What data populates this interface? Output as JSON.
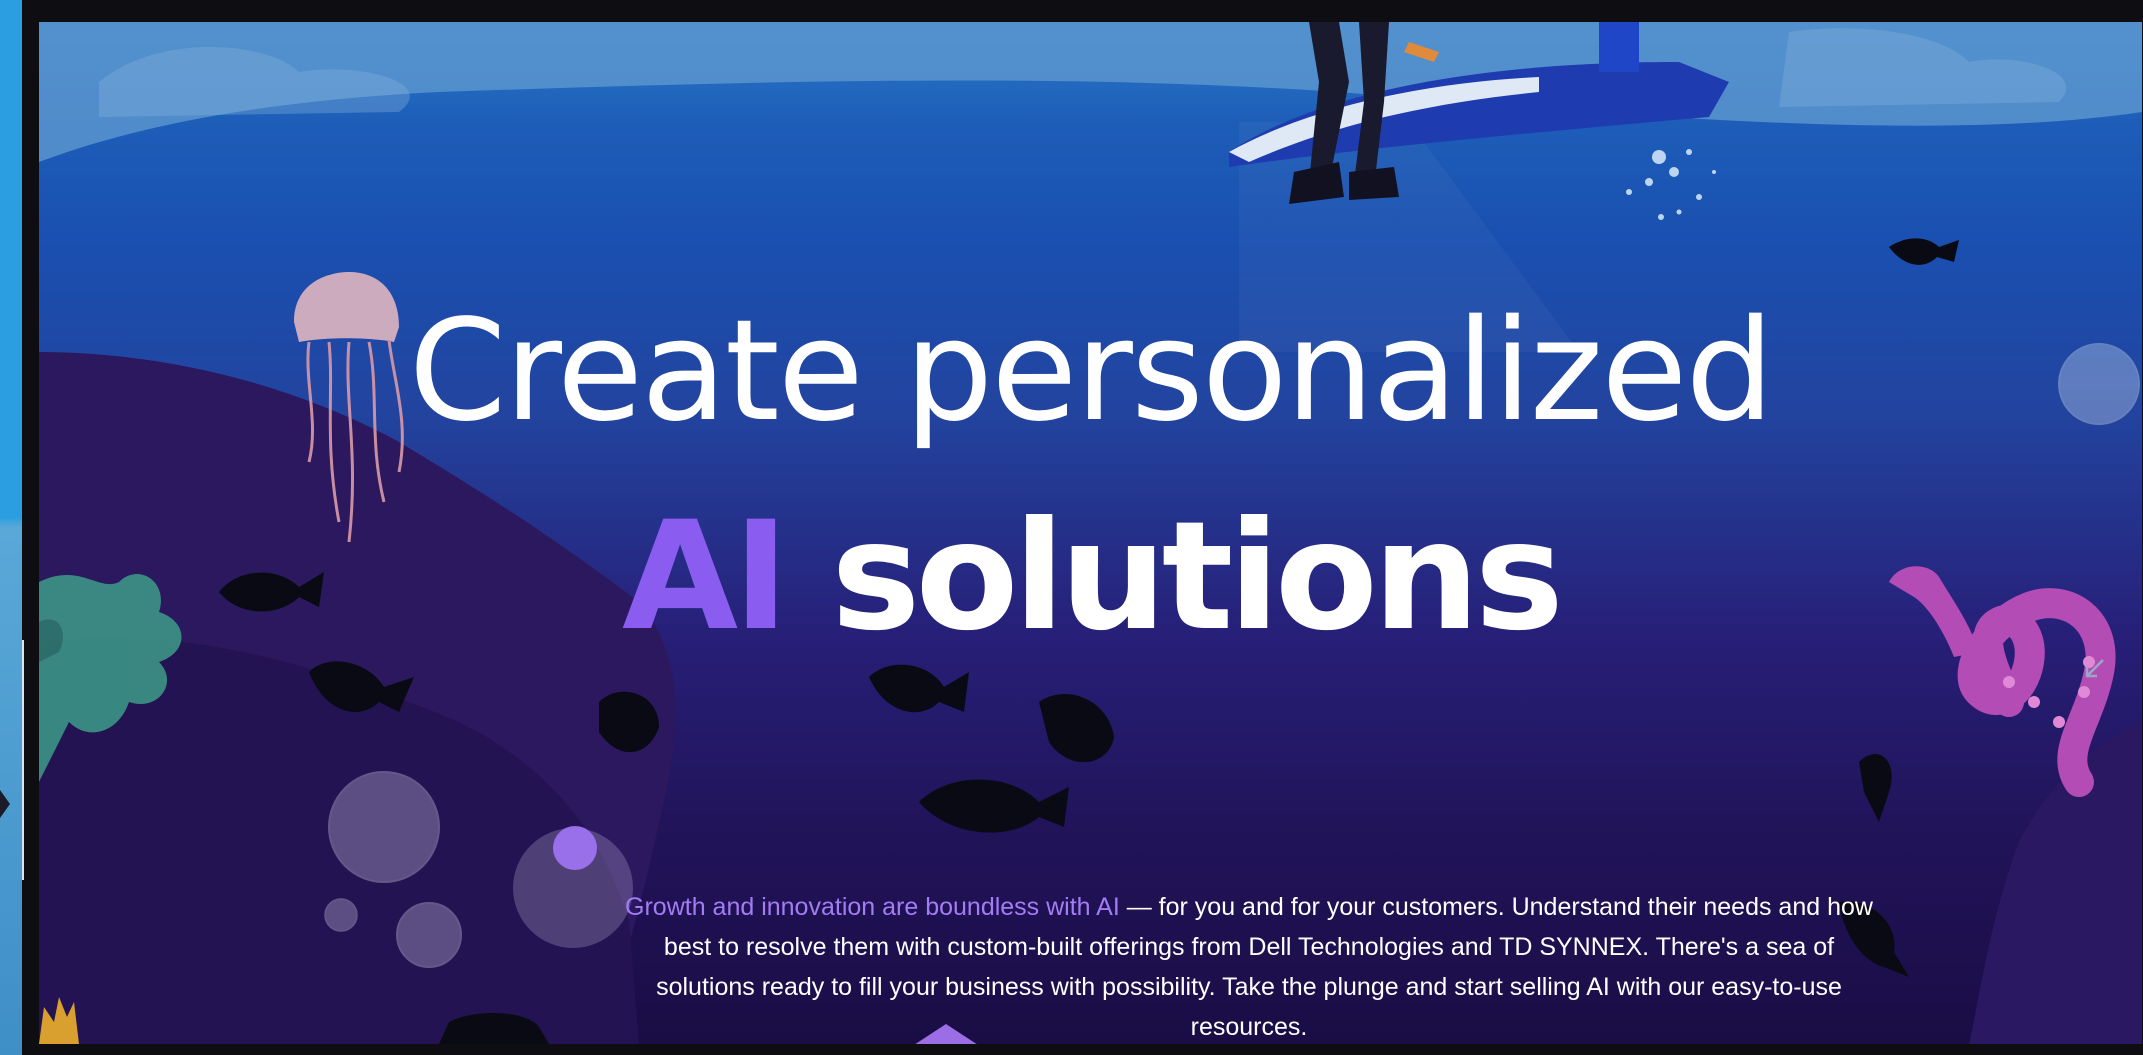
{
  "hero": {
    "headline": "Create personalized",
    "subhead_accent": "AI",
    "subhead_rest": "solutions",
    "body_highlight": "Growth and innovation are boundless with AI",
    "body_rest": " — for you and for your customers. Understand their needs and how best to resolve them with custom-built offerings from Dell Technologies and TD SYNNEX. There's a sea of solutions ready to fill your business with possibility. Take the plunge and start selling AI with our easy-to-use resources."
  },
  "colors": {
    "accent": "#8a5cf0",
    "highlight": "#a37cf5",
    "ocean_top": "#2a7bc8",
    "ocean_deep": "#1a0d45",
    "arrow": "#9b6ee6"
  },
  "icons": {
    "collapse": "arrow-down-left-icon",
    "scroll_prompt": "triangle-up-icon"
  }
}
